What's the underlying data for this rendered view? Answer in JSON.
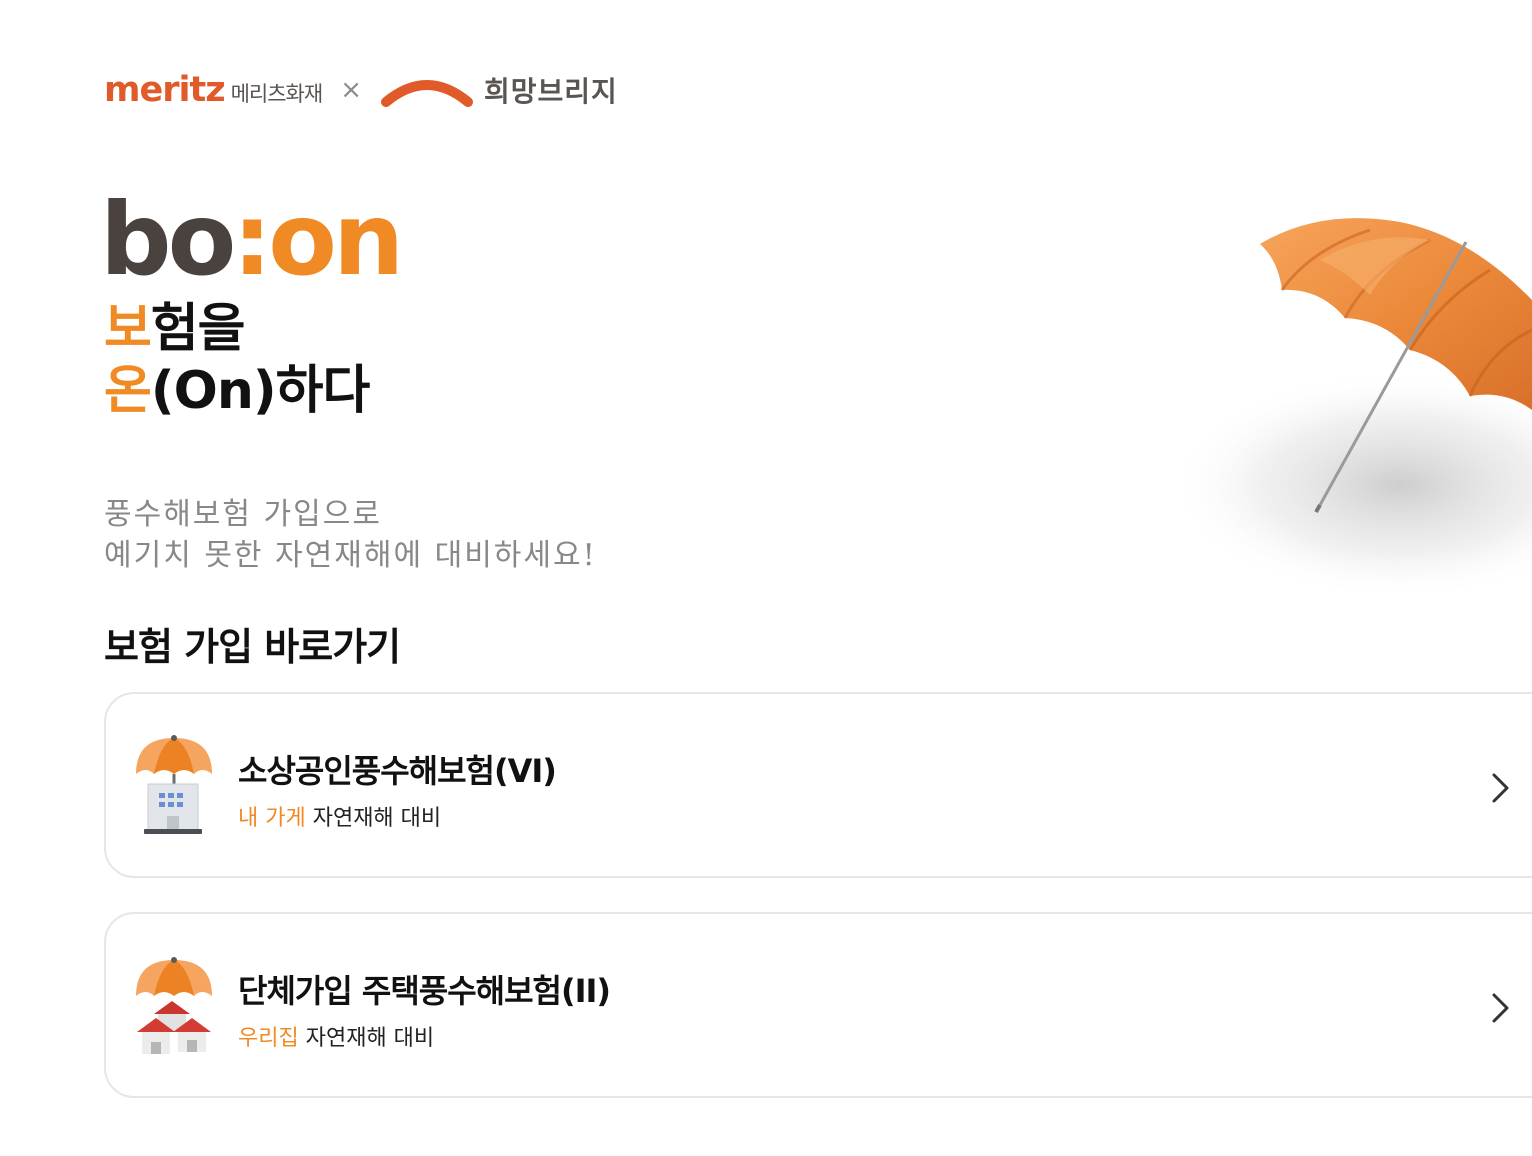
{
  "header": {
    "meritz_wordmark": "meritz",
    "meritz_korean": "메리츠화재",
    "separator": "×",
    "partner_name": "희망브리지"
  },
  "hero": {
    "logo_part1": "bo",
    "logo_colon": ":",
    "logo_part2": "on",
    "tagline_line1_highlight": "보",
    "tagline_line1_rest": "험을",
    "tagline_line2_highlight": "온",
    "tagline_line2_rest": "(On)하다",
    "subcopy_line1": "풍수해보험 가입으로",
    "subcopy_line2": "예기치 못한 자연재해에 대비하세요!"
  },
  "section": {
    "title": "보험 가입 바로가기"
  },
  "products": [
    {
      "title": "소상공인풍수해보험(VI)",
      "sub_highlight": "내 가게",
      "sub_rest": " 자연재해 대비",
      "icon": "umbrella-store-icon"
    },
    {
      "title": "단체가입 주택풍수해보험(II)",
      "sub_highlight": "우리집",
      "sub_rest": " 자연재해 대비",
      "icon": "umbrella-houses-icon"
    }
  ],
  "colors": {
    "accent_orange": "#f08a24",
    "meritz_red": "#e05a2a",
    "logo_dark": "#4a423f",
    "border": "#e6e6e6"
  }
}
